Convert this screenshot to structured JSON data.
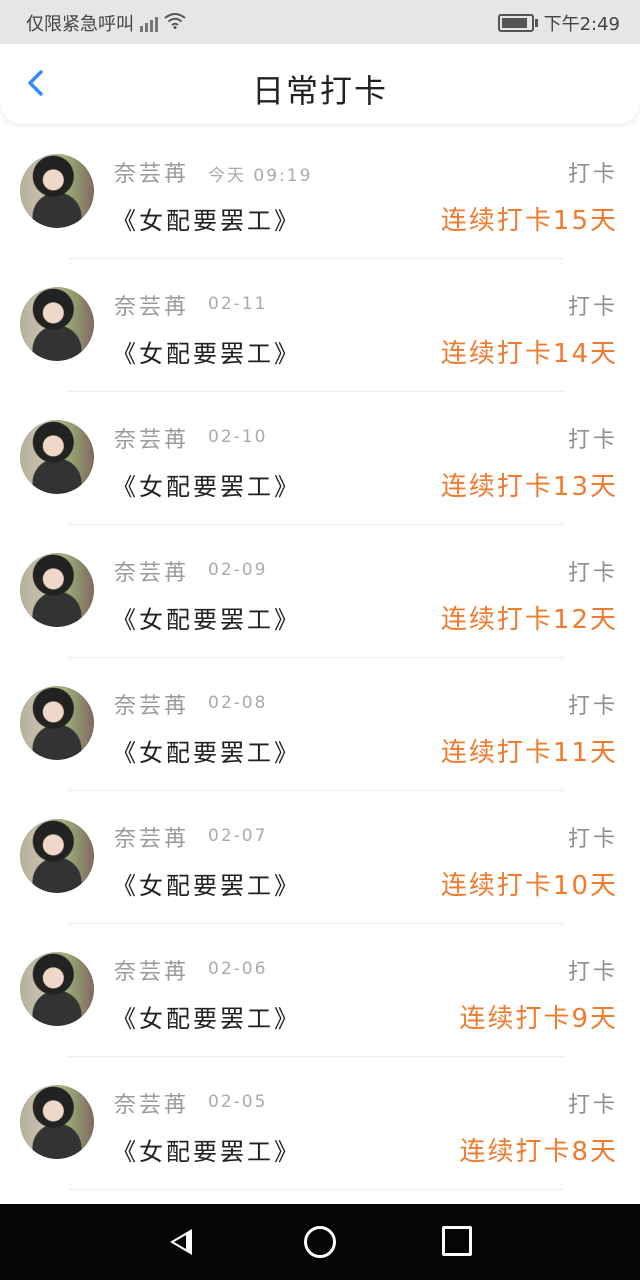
{
  "status_bar": {
    "left_text": "仅限紧急呼叫",
    "time": "下午2:49"
  },
  "header": {
    "back_icon": "chevron-left-icon",
    "title": "日常打卡"
  },
  "items": [
    {
      "name": "奈芸苒",
      "date": "今天 09:19",
      "book": "《女配要罢工》",
      "action": "打卡",
      "streak": "连续打卡15天"
    },
    {
      "name": "奈芸苒",
      "date": "02-11",
      "book": "《女配要罢工》",
      "action": "打卡",
      "streak": "连续打卡14天"
    },
    {
      "name": "奈芸苒",
      "date": "02-10",
      "book": "《女配要罢工》",
      "action": "打卡",
      "streak": "连续打卡13天"
    },
    {
      "name": "奈芸苒",
      "date": "02-09",
      "book": "《女配要罢工》",
      "action": "打卡",
      "streak": "连续打卡12天"
    },
    {
      "name": "奈芸苒",
      "date": "02-08",
      "book": "《女配要罢工》",
      "action": "打卡",
      "streak": "连续打卡11天"
    },
    {
      "name": "奈芸苒",
      "date": "02-07",
      "book": "《女配要罢工》",
      "action": "打卡",
      "streak": "连续打卡10天"
    },
    {
      "name": "奈芸苒",
      "date": "02-06",
      "book": "《女配要罢工》",
      "action": "打卡",
      "streak": "连续打卡9天"
    },
    {
      "name": "奈芸苒",
      "date": "02-05",
      "book": "《女配要罢工》",
      "action": "打卡",
      "streak": "连续打卡8天"
    }
  ],
  "colors": {
    "accent": "#2f8cff",
    "streak": "#f07a2e"
  }
}
